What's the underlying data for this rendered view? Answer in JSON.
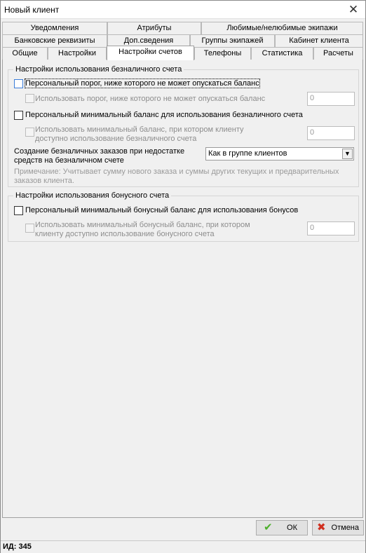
{
  "window": {
    "title": "Новый клиент",
    "close_icon": "close-icon"
  },
  "tabs": {
    "row1": [
      "Уведомления",
      "Атрибуты",
      "Любимые/нелюбимые экипажи"
    ],
    "row2": [
      "Банковские реквизиты",
      "Доп.сведения",
      "Группы экипажей",
      "Кабинет клиента"
    ],
    "row3": [
      "Общие",
      "Настройки",
      "Настройки счетов",
      "Телефоны",
      "Статистика",
      "Расчеты"
    ],
    "active": "Настройки счетов"
  },
  "cashless": {
    "group_title": "Настройки использования безналичного счета",
    "threshold_label": "Персональный порог, ниже которого не может опускаться баланс",
    "threshold_sub_label": "Использовать порог, ниже которого не может опускаться баланс",
    "threshold_value": "0",
    "min_balance_label": "Персональный минимальный баланс для использования безналичного счета",
    "min_balance_sub_label_1": "Использовать минимальный баланс, при котором клиенту",
    "min_balance_sub_label_2": "доступно использование безналичного счета",
    "min_balance_value": "0",
    "orders_label_1": "Создание безналичных заказов при недостатке",
    "orders_label_2": "средств на безналичном счете",
    "orders_select": "Как в группе клиентов",
    "note_1": "Примечание: Учитывает сумму нового заказа и суммы других текущих и предварительных",
    "note_2": "заказов клиента."
  },
  "bonus": {
    "group_title": "Настройки использования бонусного счета",
    "min_bonus_label": "Персональный минимальный бонусный баланс для использования бонусов",
    "min_bonus_sub_label_1": "Использовать минимальный бонусный баланс, при котором",
    "min_bonus_sub_label_2": "клиенту доступно использование бонусного счета",
    "min_bonus_value": "0"
  },
  "buttons": {
    "ok": "ОК",
    "cancel": "Отмена"
  },
  "status": {
    "id_text": "ИД: 345"
  }
}
